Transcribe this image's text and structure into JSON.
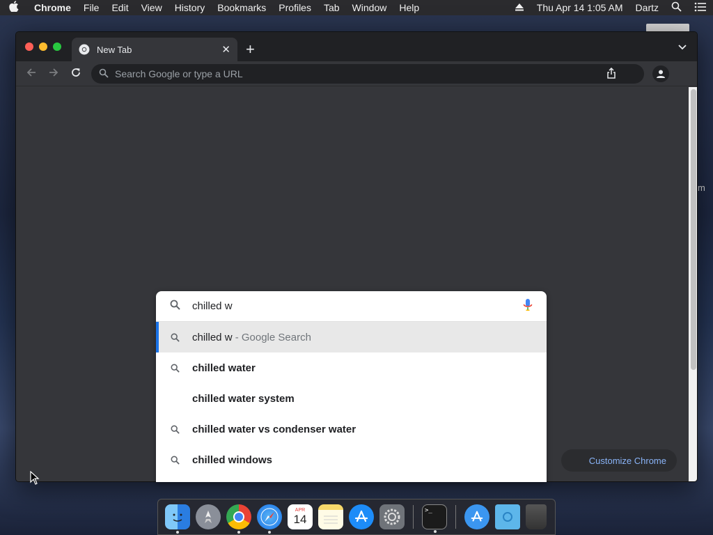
{
  "menubar": {
    "app_name": "Chrome",
    "items": [
      "File",
      "Edit",
      "View",
      "History",
      "Bookmarks",
      "Profiles",
      "Tab",
      "Window",
      "Help"
    ],
    "clock": "Thu Apr 14  1:05 AM",
    "user": "Dartz"
  },
  "desktop": {
    "partial_label": "m"
  },
  "browser": {
    "tab_title": "New Tab",
    "omnibox_placeholder": "Search Google or type a URL",
    "customize_label": "Customize Chrome"
  },
  "autocomplete": {
    "query": "chilled w",
    "suggestions": [
      {
        "text": "chilled w",
        "hint": " - Google Search",
        "icon": "search-icon",
        "selected": true
      },
      {
        "text": "chilled water",
        "hint": "",
        "icon": "search-icon",
        "selected": false
      },
      {
        "text": "chilled water system",
        "hint": "",
        "icon": "",
        "selected": false
      },
      {
        "text": "chilled water vs condenser water",
        "hint": "",
        "icon": "search-icon",
        "selected": false
      },
      {
        "text": "chilled windows",
        "hint": "",
        "icon": "search-icon",
        "selected": false
      }
    ]
  },
  "dock": {
    "calendar_month": "APR",
    "calendar_day": "14",
    "terminal_prompt": ">_",
    "apps": [
      "Finder",
      "Launchpad",
      "Google Chrome",
      "Safari",
      "Calendar",
      "Notes",
      "App Store",
      "System Preferences",
      "Terminal",
      "Applications",
      "Downloads",
      "Trash"
    ]
  },
  "colors": {
    "accent": "#1a73e8",
    "link": "#8ab4f8",
    "toolbar": "#35363a",
    "tabstrip": "#202124"
  }
}
